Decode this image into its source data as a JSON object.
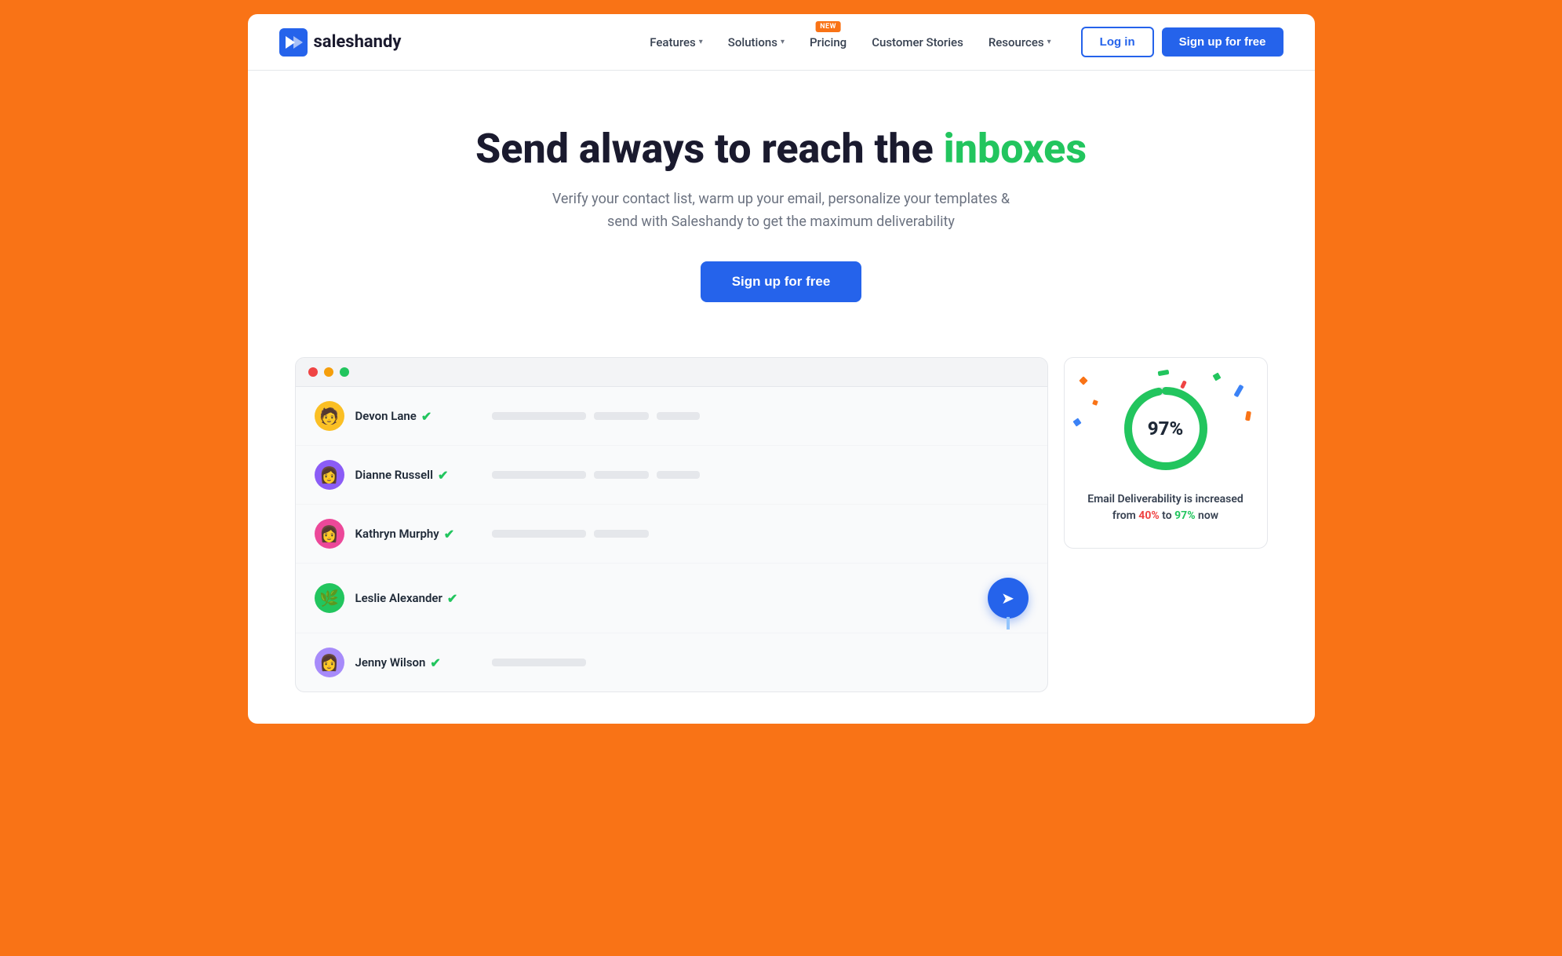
{
  "brand": {
    "name": "saleshandy",
    "logo_alt": "Saleshandy Logo"
  },
  "nav": {
    "links": [
      {
        "id": "features",
        "label": "Features",
        "has_dropdown": true,
        "badge": null
      },
      {
        "id": "solutions",
        "label": "Solutions",
        "has_dropdown": true,
        "badge": null
      },
      {
        "id": "pricing",
        "label": "Pricing",
        "has_dropdown": false,
        "badge": "NEW"
      },
      {
        "id": "customer-stories",
        "label": "Customer Stories",
        "has_dropdown": false,
        "badge": null
      },
      {
        "id": "resources",
        "label": "Resources",
        "has_dropdown": true,
        "badge": null
      }
    ],
    "login_label": "Log in",
    "signup_label": "Sign up for free"
  },
  "hero": {
    "title_part1": "Send always to reach the ",
    "title_highlight": "inboxes",
    "subtitle": "Verify your contact list, warm up your email, personalize your templates & send with Saleshandy to get the maximum deliverability",
    "cta_label": "Sign up for free"
  },
  "contacts": [
    {
      "id": "devon",
      "name": "Devon Lane",
      "avatar_emoji": "🧑",
      "avatar_class": "avatar-devon"
    },
    {
      "id": "dianne",
      "name": "Dianne Russell",
      "avatar_emoji": "👩",
      "avatar_class": "avatar-dianne"
    },
    {
      "id": "kathryn",
      "name": "Kathryn Murphy",
      "avatar_emoji": "👩",
      "avatar_class": "avatar-kathryn"
    },
    {
      "id": "leslie",
      "name": "Leslie Alexander",
      "avatar_emoji": "🌿",
      "avatar_class": "avatar-leslie"
    },
    {
      "id": "jenny",
      "name": "Jenny Wilson",
      "avatar_emoji": "👩",
      "avatar_class": "avatar-jenny"
    }
  ],
  "stats_card": {
    "percentage": "97%",
    "description_prefix": "Email Deliverability is increased from ",
    "from_value": "40%",
    "description_middle": " to ",
    "to_value": "97%",
    "description_suffix": " now",
    "donut_progress": 97,
    "confetti": [
      {
        "color": "#F97316",
        "top": "10%",
        "left": "8%",
        "rotation": "45deg"
      },
      {
        "color": "#F97316",
        "top": "20%",
        "left": "15%",
        "rotation": "20deg"
      },
      {
        "color": "#22c55e",
        "top": "8%",
        "left": "75%",
        "rotation": "60deg"
      },
      {
        "color": "#3b82f6",
        "top": "15%",
        "left": "85%",
        "rotation": "30deg"
      },
      {
        "color": "#F97316",
        "top": "25%",
        "right": "10%",
        "rotation": "10deg"
      },
      {
        "color": "#22c55e",
        "top": "5%",
        "left": "50%",
        "rotation": "80deg"
      },
      {
        "color": "#3b82f6",
        "top": "30%",
        "left": "5%",
        "rotation": "55deg"
      },
      {
        "color": "#ef4444",
        "top": "12%",
        "left": "60%",
        "rotation": "25deg"
      }
    ]
  }
}
